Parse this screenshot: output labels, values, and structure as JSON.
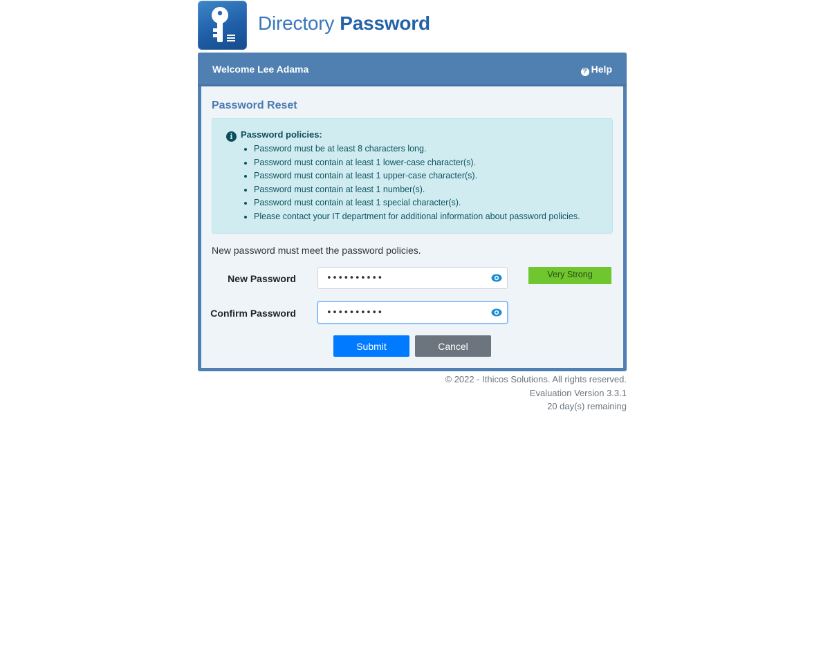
{
  "brand": {
    "name_part1": "Directory",
    "name_part2": "Password",
    "logo_icon": "key-document-icon",
    "colors": {
      "primary": "#5080b1",
      "logo": "#2462a8"
    }
  },
  "header": {
    "welcome": "Welcome Lee Adama",
    "help_label": "Help",
    "help_icon": "question-circle-icon"
  },
  "reset": {
    "title": "Password Reset",
    "policy_title": "Password policies:",
    "policies": [
      "Password must be at least 8 characters long.",
      "Password must contain at least 1 lower-case character(s).",
      "Password must contain at least 1 upper-case character(s).",
      "Password must contain at least 1 number(s).",
      "Password must contain at least 1 special character(s).",
      "Please contact your IT department for additional information about password policies."
    ],
    "requirement_note": "New password must meet the password policies."
  },
  "form": {
    "new_password_label": "New Password",
    "new_password_value": "••••••••••",
    "confirm_password_label": "Confirm Password",
    "confirm_password_value": "••••••••••",
    "strength_label": "Very Strong",
    "strength_color": "#6fc62e",
    "submit_label": "Submit",
    "cancel_label": "Cancel"
  },
  "footer": {
    "copyright": "© 2022 - Ithicos Solutions. All rights reserved.",
    "version": "Evaluation Version 3.3.1",
    "remaining": "20 day(s) remaining"
  }
}
